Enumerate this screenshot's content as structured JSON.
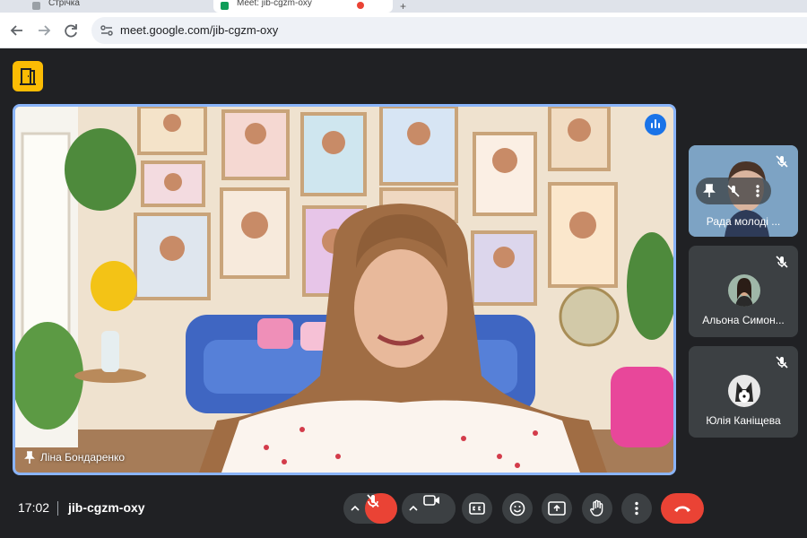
{
  "browser": {
    "tabs": [
      {
        "title": "Стрічка"
      },
      {
        "title": "Meet: jib-cgzm-oxy"
      }
    ],
    "url": "meet.google.com/jib-cgzm-oxy"
  },
  "meeting": {
    "time": "17:02",
    "code": "jib-cgzm-oxy"
  },
  "main_participant": {
    "name": "Ліна Бондаренко"
  },
  "side_participants": [
    {
      "name": "Рада молоді ..."
    },
    {
      "name": "Альона Симон..."
    },
    {
      "name": "Юлія Каніщева"
    }
  ],
  "colors": {
    "background": "#202124",
    "tile": "#3c4043",
    "speaking_border": "#8ab4f8",
    "mic_off": "#ea4335",
    "leave": "#ea4335",
    "meet_logo": "#fbbc04"
  },
  "controls": [
    "mic-toggle",
    "camera-toggle",
    "captions",
    "reactions",
    "present",
    "raise-hand",
    "more-options",
    "leave-call"
  ]
}
